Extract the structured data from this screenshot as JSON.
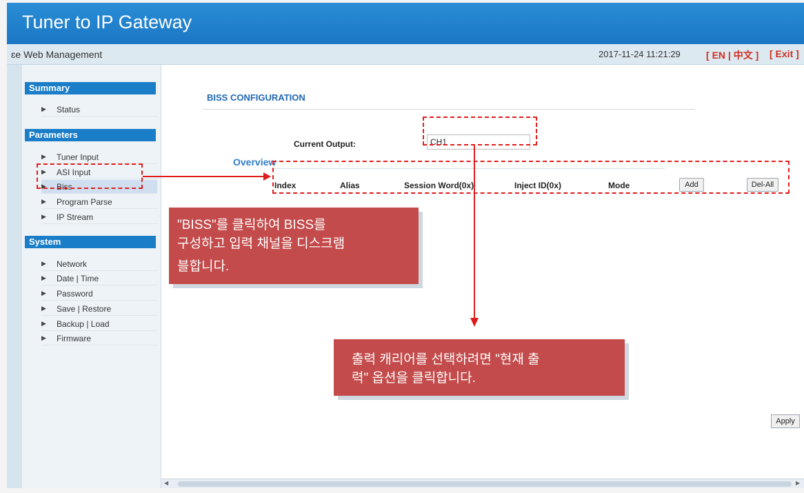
{
  "app": {
    "title": "Tuner to IP Gateway"
  },
  "subbar": {
    "title": "ɛe Web Management",
    "datetime": "2017-11-24 11:21:29",
    "lang_open": "[",
    "lang_en": "EN",
    "lang_sep": "|",
    "lang_zh": "中文",
    "lang_close": "]",
    "exit": "[ Exit ]"
  },
  "sidebar": {
    "summary_header": "Summary",
    "summary_items": [
      {
        "label": "Status"
      }
    ],
    "parameters_header": "Parameters",
    "parameters_items": [
      {
        "label": "Tuner Input"
      },
      {
        "label": "ASI Input"
      },
      {
        "label": "Biss"
      },
      {
        "label": "Program Parse"
      },
      {
        "label": "IP Stream"
      }
    ],
    "system_header": "System",
    "system_items": [
      {
        "label": "Network"
      },
      {
        "label": "Date | Time"
      },
      {
        "label": "Password"
      },
      {
        "label": "Save | Restore"
      },
      {
        "label": "Backup | Load"
      },
      {
        "label": "Firmware"
      }
    ]
  },
  "main": {
    "page_title": "BISS CONFIGURATION",
    "current_output_label": "Current Output:",
    "current_output_value": "CH1",
    "overview_label": "Overview",
    "table_headers": {
      "index": "Index",
      "alias": "Alias",
      "session_word": "Session Word(0x)",
      "inject_id": "Inject ID(0x)",
      "mode": "Mode"
    },
    "add_button": "Add",
    "del_all_button": "Del-All",
    "apply_button": "Apply"
  },
  "annotations": {
    "callout1_lines": [
      "\"BISS\"를 클릭하여 BISS를",
      "구성하고 입력 채널을 디스크램",
      "블합니다."
    ],
    "callout2_lines": [
      "출력 캐리어를 선택하려면 \"현재 출",
      "력\" 옵션을 클릭합니다."
    ],
    "color": "#e01b1b"
  },
  "colors": {
    "header_blue": "#1a76c4",
    "section_blue": "#1a7dc8",
    "link_red": "#d12d1f",
    "callout_bg": "#c44b4b"
  }
}
